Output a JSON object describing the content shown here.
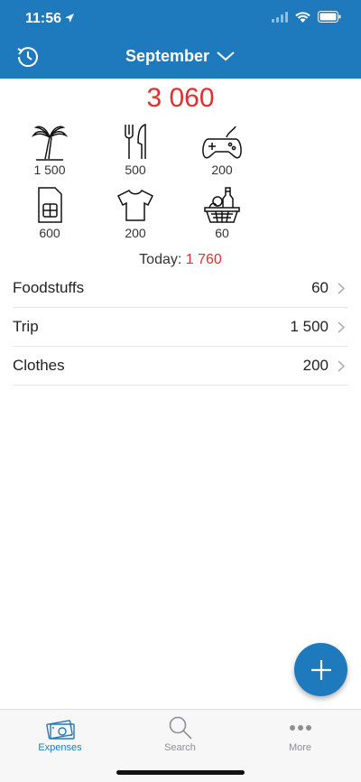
{
  "status": {
    "time": "11:56"
  },
  "nav": {
    "month": "September"
  },
  "total": "3 060",
  "categories": [
    {
      "icon": "palm-tree-icon",
      "amount": "1 500"
    },
    {
      "icon": "fork-knife-icon",
      "amount": "500"
    },
    {
      "icon": "gamepad-icon",
      "amount": "200"
    },
    {
      "icon": "sim-card-icon",
      "amount": "600"
    },
    {
      "icon": "tshirt-icon",
      "amount": "200"
    },
    {
      "icon": "shopping-basket-icon",
      "amount": "60"
    }
  ],
  "today": {
    "label": "Today:",
    "value": "1 760"
  },
  "expenses": [
    {
      "name": "Foodstuffs",
      "value": "60"
    },
    {
      "name": "Trip",
      "value": "1 500"
    },
    {
      "name": "Clothes",
      "value": "200"
    }
  ],
  "tabs": [
    {
      "label": "Expenses",
      "icon": "money-icon"
    },
    {
      "label": "Search",
      "icon": "search-icon"
    },
    {
      "label": "More",
      "icon": "more-icon"
    }
  ],
  "colors": {
    "accent": "#1f79bd",
    "total": "#e0302f"
  }
}
